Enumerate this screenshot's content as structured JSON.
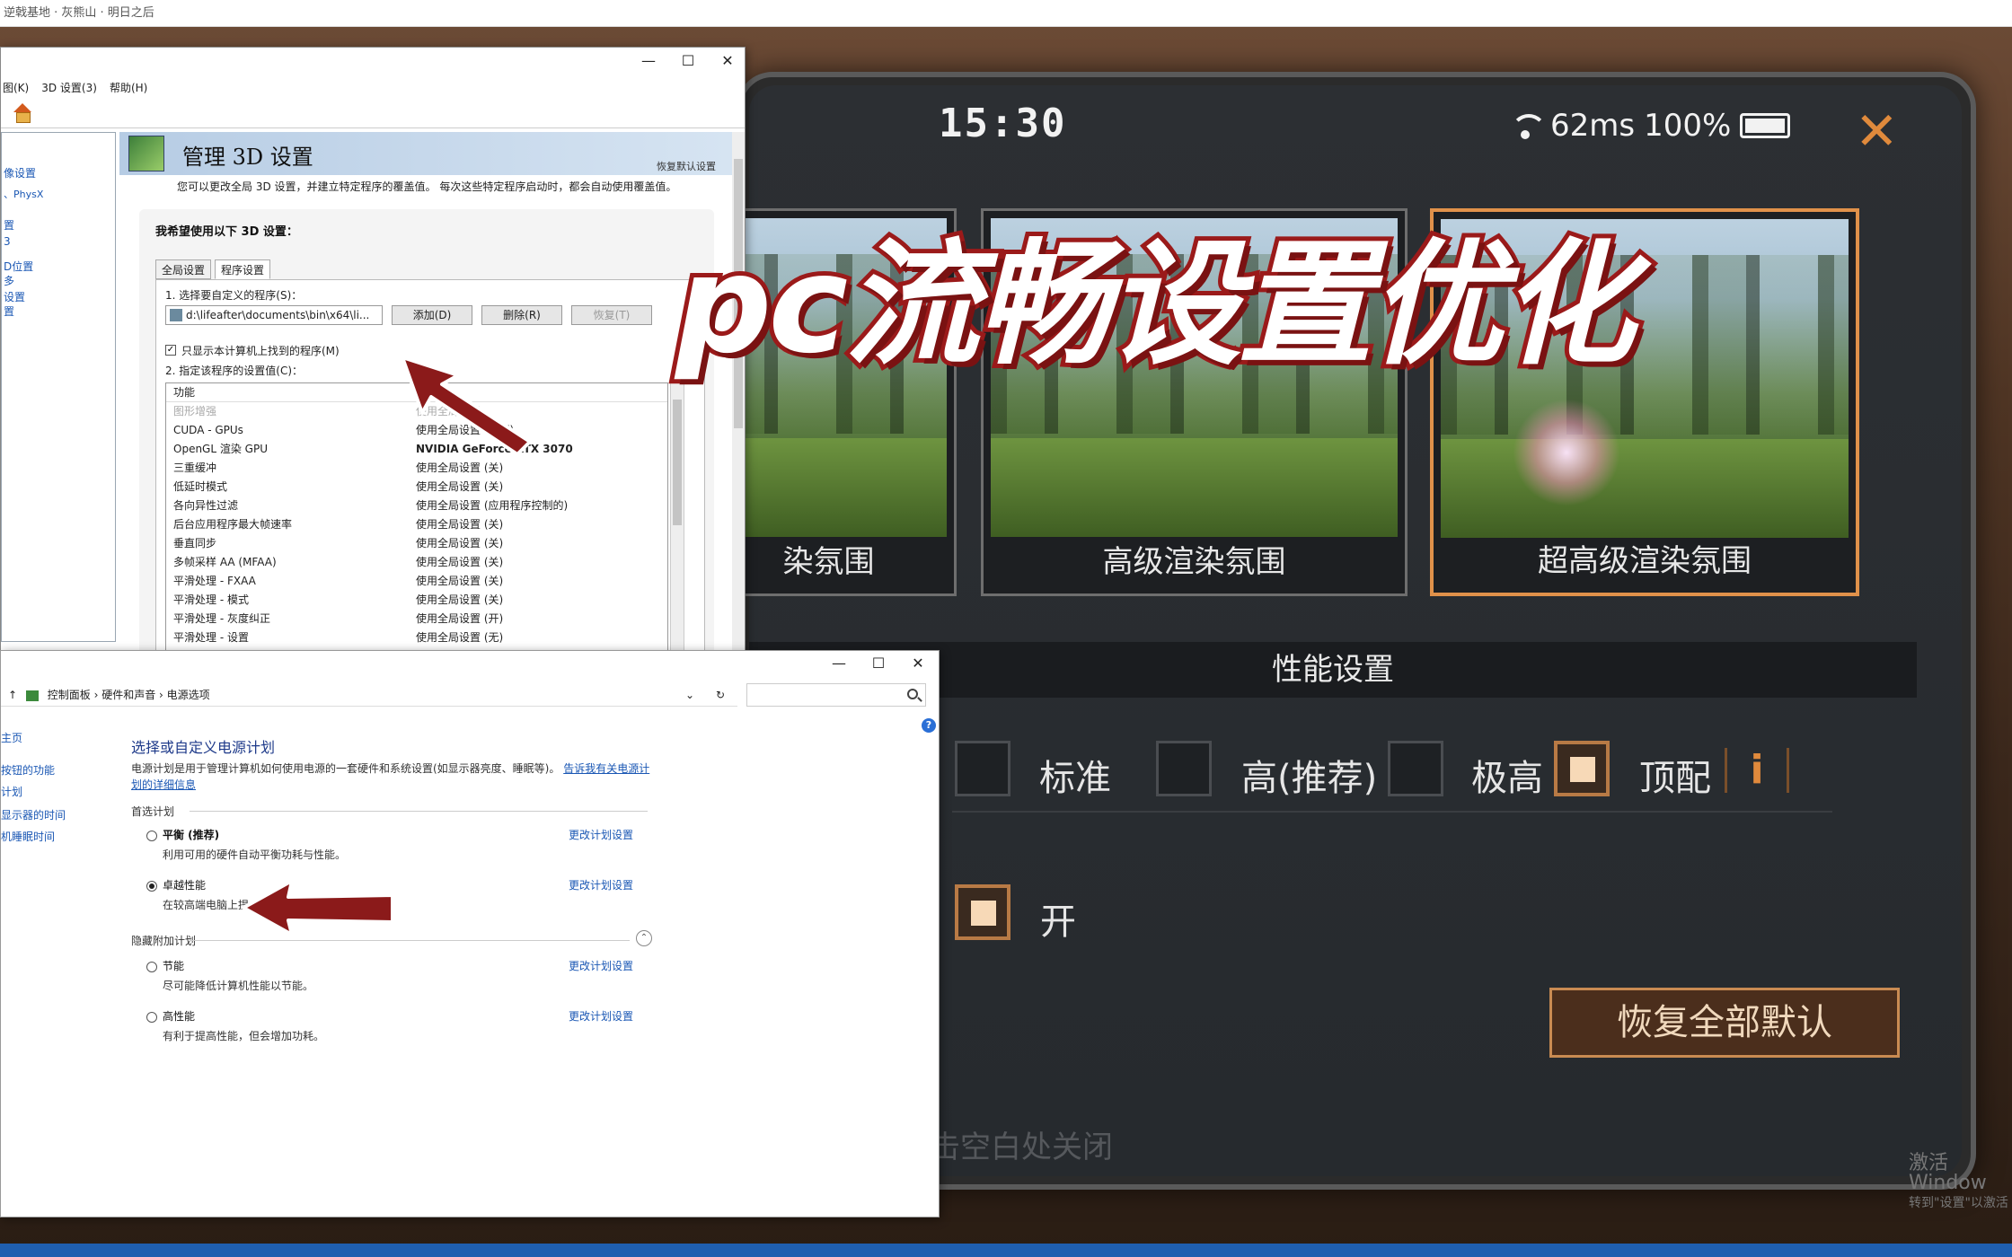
{
  "outer_window": {
    "title": "逆戟基地 · 灰熊山 · 明日之后"
  },
  "game": {
    "status": {
      "time": "15:30",
      "ping": "62ms",
      "battery": "100%"
    },
    "render_cards": [
      {
        "label": "染氛围"
      },
      {
        "label": "高级渲染氛围"
      },
      {
        "label": "超高级渲染氛围"
      }
    ],
    "perf_title": "性能设置",
    "quality_options": [
      "标准",
      "高(推荐)",
      "极高",
      "顶配"
    ],
    "info_label": "i",
    "toggle_label": "开",
    "reset_button": "恢复全部默认",
    "close_hint": "击空白处关闭",
    "watermark_line1": "激活 Window",
    "watermark_line2": "转到\"设置\"以激活"
  },
  "overlay_title": "pc流畅设置优化",
  "nvidia": {
    "menu": [
      "图(K)",
      "3D 设置(3)",
      "帮助(H)"
    ],
    "left_items": [
      "像设置",
      "、PhysX",
      "置",
      "3",
      "D位置",
      "多",
      "设置",
      "置"
    ],
    "header_title": "管理 3D 设置",
    "restore_link": "恢复默认设置",
    "description": "您可以更改全局 3D 设置，并建立特定程序的覆盖值。 每次这些特定程序启动时，都会自动使用覆盖值。",
    "question": "我希望使用以下 3D 设置：",
    "tabs": [
      "全局设置",
      "程序设置"
    ],
    "step1": "1. 选择要自定义的程序(S)：",
    "program_path": "d:\\lifeafter\\documents\\bin\\x64\\li...",
    "btn_add": "添加(D)",
    "btn_remove": "删除(R)",
    "btn_restore": "恢复(T)",
    "only_show_label": "只显示本计算机上找到的程序(M)",
    "step2": "2. 指定该程序的设置值(C)：",
    "grid_headers": [
      "功能",
      "设置"
    ],
    "grid_rows": [
      {
        "feature": "图形增强",
        "value": "使用全局设置"
      },
      {
        "feature": "CUDA - GPUs",
        "value": "使用全局设置 (全部)"
      },
      {
        "feature": "OpenGL 渲染 GPU",
        "value": "NVIDIA GeForce RTX 3070"
      },
      {
        "feature": "三重缓冲",
        "value": "使用全局设置 (关)"
      },
      {
        "feature": "低延时模式",
        "value": "使用全局设置 (关)"
      },
      {
        "feature": "各向异性过滤",
        "value": "使用全局设置 (应用程序控制的)"
      },
      {
        "feature": "后台应用程序最大帧速率",
        "value": "使用全局设置 (关)"
      },
      {
        "feature": "垂直同步",
        "value": "使用全局设置 (关)"
      },
      {
        "feature": "多帧采样 AA (MFAA)",
        "value": "使用全局设置 (关)"
      },
      {
        "feature": "平滑处理 - FXAA",
        "value": "使用全局设置 (关)"
      },
      {
        "feature": "平滑处理 - 模式",
        "value": "使用全局设置 (关)"
      },
      {
        "feature": "平滑处理 - 灰度纠正",
        "value": "使用全局设置 (开)"
      },
      {
        "feature": "平滑处理 - 设置",
        "value": "使用全局设置 (无)"
      }
    ]
  },
  "power": {
    "breadcrumb": [
      "控制面板",
      "硬件和声音",
      "电源选项"
    ],
    "left_links": [
      "主页",
      "按钮的功能",
      "计划",
      "显示器的时间",
      "机睡眠时间"
    ],
    "title": "选择或自定义电源计划",
    "desc_text": "电源计划是用于管理计算机如何使用电源的一套硬件和系统设置(如显示器亮度、睡眠等)。",
    "desc_link": "告诉我有关电源计划的详细信息",
    "preferred_label": "首选计划",
    "hidden_label": "隐藏附加计划",
    "plans": [
      {
        "name": "平衡 (推荐)",
        "sub": "利用可用的硬件自动平衡功耗与性能。",
        "link": "更改计划设置"
      },
      {
        "name": "卓越性能",
        "sub": "在较高端电脑上提",
        "link": "更改计划设置"
      },
      {
        "name": "节能",
        "sub": "尽可能降低计算机性能以节能。",
        "link": "更改计划设置"
      },
      {
        "name": "高性能",
        "sub": "有利于提高性能，但会增加功耗。",
        "link": "更改计划设置"
      }
    ]
  },
  "colors": {
    "accent_orange": "#e0914a",
    "arrow_red": "#8b1a1a",
    "title_stroke": "#9b1a1a"
  }
}
